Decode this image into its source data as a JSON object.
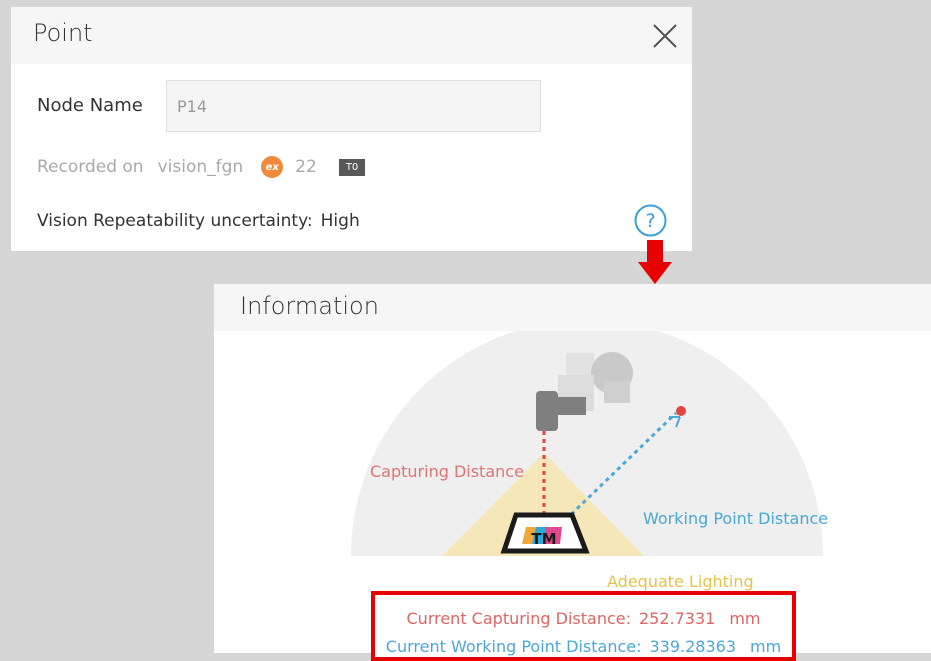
{
  "point_dialog": {
    "title": "Point",
    "node_name_label": "Node Name",
    "node_name_value": "P14",
    "recorded_on_label": "Recorded on",
    "recorded_on_value": "vision_fgn",
    "badge_icon": "vision-job-icon",
    "badge_text": "ex",
    "job_number": "22",
    "tool_label": "T0",
    "vision_repeatability_label": "Vision Repeatability uncertainty:",
    "vision_repeatability_value": "High"
  },
  "information_panel": {
    "title": "Information",
    "diagram": {
      "capturing_distance_label": "Capturing Distance",
      "working_point_distance_label": "Working Point Distance",
      "adequate_lighting_label": "Adequate Lighting",
      "logo_text": "TM"
    },
    "readout": {
      "capturing_label": "Current Capturing Distance:",
      "capturing_value": "252.7331",
      "capturing_unit": "mm",
      "working_label": "Current Working Point Distance:",
      "working_value": "339.28363",
      "working_unit": "mm"
    }
  },
  "colors": {
    "capture": "#e07373",
    "working": "#4aa8d8",
    "lighting": "#e6c347",
    "highlight_box": "#e60000",
    "arrow": "#e60000",
    "help_icon": "#3aa0d8"
  }
}
